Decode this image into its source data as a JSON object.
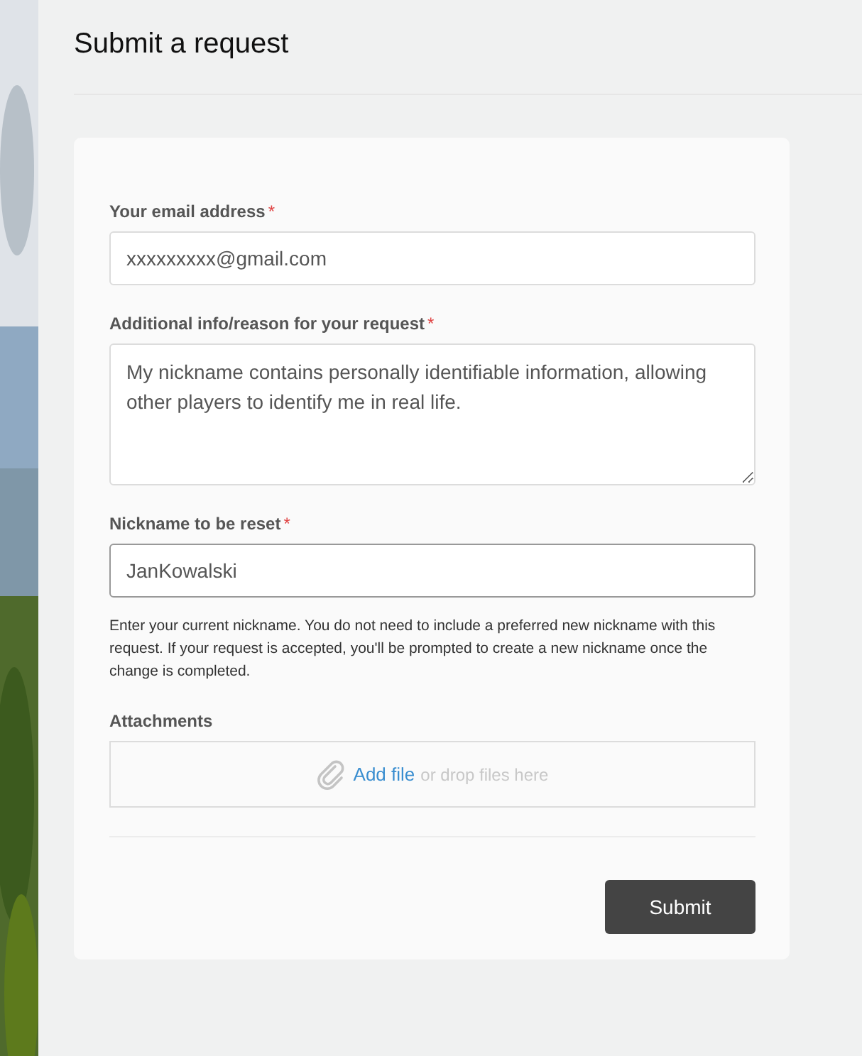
{
  "page": {
    "title": "Submit a request"
  },
  "fields": [
    {
      "kind": "input",
      "label": "Your email address",
      "required_mark": "*",
      "value": "xxxxxxxxx@gmail.com",
      "focused": false
    },
    {
      "kind": "textarea",
      "label": "Additional info/reason for your request",
      "required_mark": "*",
      "value": "My nickname contains personally identifiable information, allowing other players to identify me in real life.",
      "focused": false
    },
    {
      "kind": "input",
      "label": "Nickname to be reset",
      "required_mark": "*",
      "value": "JanKowalski",
      "focused": true,
      "hint": "Enter your current nickname. You do not need to include a preferred new nickname with this request. If your request is accepted, you'll be prompted to create a new nickname once the change is completed."
    },
    {
      "kind": "attachments",
      "label": "Attachments",
      "link": "Add file",
      "text": "or drop files here"
    }
  ],
  "submit": "Submit"
}
